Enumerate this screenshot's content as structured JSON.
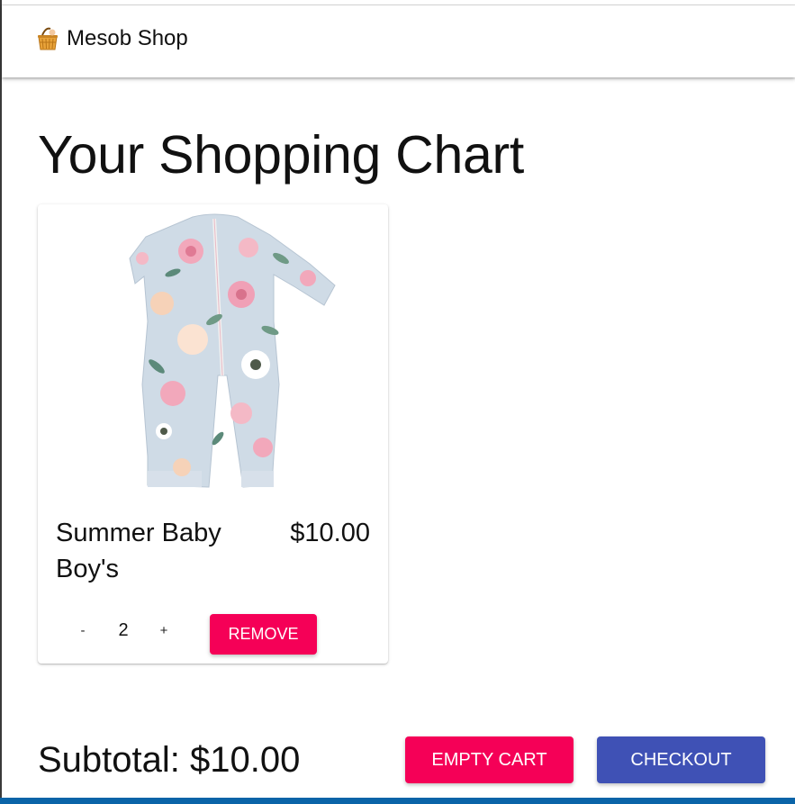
{
  "app": {
    "title": "Mesob Shop",
    "icon": "basket-icon"
  },
  "page": {
    "title": "Your Shopping Chart"
  },
  "cart": {
    "items": [
      {
        "name": "Summer Baby Boy's",
        "price": "$10.00",
        "quantity": "2",
        "decrement_label": "-",
        "increment_label": "+",
        "remove_label": "Remove",
        "image": "floral-baby-romper"
      }
    ],
    "subtotal": "Subtotal: $10.00",
    "empty_label": "Empty Cart",
    "checkout_label": "Checkout"
  },
  "colors": {
    "secondary": "#f50057",
    "primary": "#3f51b5",
    "taskbar": "#0a64a8"
  }
}
